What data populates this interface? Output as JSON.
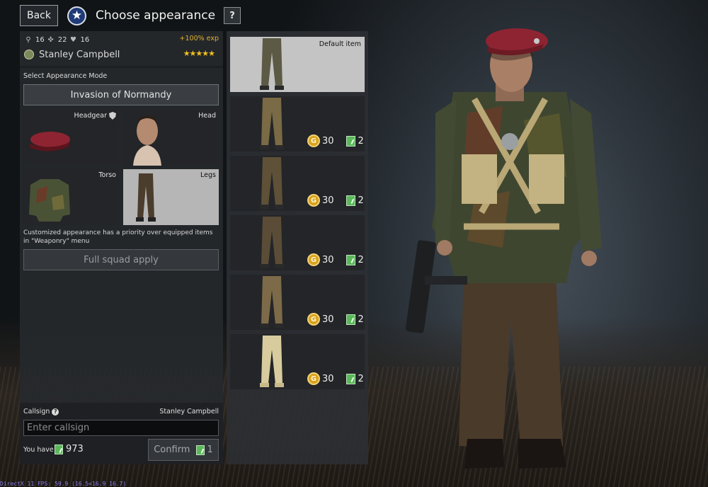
{
  "header": {
    "back_label": "Back",
    "title": "Choose appearance",
    "help_label": "?"
  },
  "soldier": {
    "stats": [
      {
        "icon": "parachute-icon",
        "value": "16"
      },
      {
        "icon": "rifle-icon",
        "value": "22"
      },
      {
        "icon": "medic-heart-icon",
        "value": "16"
      }
    ],
    "exp_bonus": "+100% exp",
    "name": "Stanley Campbell",
    "rating_stars": "★★★★★",
    "rating": 5
  },
  "appearance_mode": {
    "label": "Select Appearance Mode",
    "selected": "Invasion of Normandy"
  },
  "slots": [
    {
      "key": "headgear",
      "label": "Headgear",
      "locked_icon": "shield-icon",
      "selected": false
    },
    {
      "key": "head",
      "label": "Head",
      "selected": false
    },
    {
      "key": "torso",
      "label": "Torso",
      "selected": false
    },
    {
      "key": "legs",
      "label": "Legs",
      "selected": true
    }
  ],
  "notice": "Customized appearance has a priority over equipped items in \"Weaponry\" menu",
  "full_squad_apply_label": "Full squad apply",
  "callsign": {
    "label": "Callsign",
    "help_icon": "?",
    "current": "Stanley Campbell",
    "placeholder": "Enter callsign",
    "value": ""
  },
  "wallet": {
    "you_have_label": "You have",
    "tickets": "973"
  },
  "confirm": {
    "label": "Confirm",
    "cost": "1"
  },
  "items": [
    {
      "label": "Default item",
      "default": true,
      "color": "#5c5a45"
    },
    {
      "gold": "30",
      "tickets": "2",
      "color": "#7a6a45"
    },
    {
      "gold": "30",
      "tickets": "2",
      "color": "#5e5138"
    },
    {
      "gold": "30",
      "tickets": "2",
      "color": "#5a4c36"
    },
    {
      "gold": "30",
      "tickets": "2",
      "color": "#7d6a48"
    },
    {
      "gold": "30",
      "tickets": "2",
      "color": "#d8cc9e"
    }
  ],
  "currency_icons": {
    "gold": "gold-coin-icon",
    "ticket": "ticket-icon",
    "gold_glyph": "G"
  },
  "debug_overlay": "DirectX 11 FPS: 59.9 (16.5<16.9 16.7)",
  "colors": {
    "accent_gold": "#e0b030",
    "ticket_green": "#5bb85a",
    "beret": "#8e2432"
  }
}
